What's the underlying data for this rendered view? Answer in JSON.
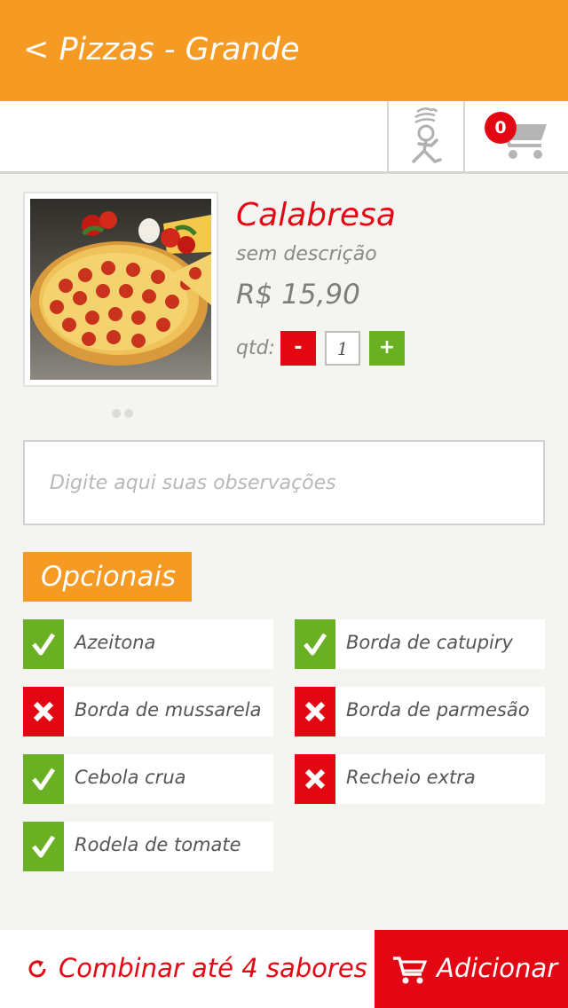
{
  "header": {
    "back_label": "< Pizzas - Grande"
  },
  "toolbar": {
    "cart_count": "0",
    "chef_icon": "delivery-chef-icon",
    "cart_icon": "cart-icon"
  },
  "product": {
    "name": "Calabresa",
    "description": "sem descrição",
    "price": "R$ 15,90",
    "qty_label": "qtd:",
    "qty_value": "1",
    "minus_label": "-",
    "plus_label": "+",
    "image_page": 1,
    "image_pages": 2
  },
  "observations": {
    "placeholder": "Digite aqui suas observações",
    "value": ""
  },
  "options": {
    "title": "Opcionais",
    "items": [
      {
        "label": "Azeitona",
        "checked": true
      },
      {
        "label": "Borda de catupiry",
        "checked": true
      },
      {
        "label": "Borda de mussarela",
        "checked": false
      },
      {
        "label": "Borda de parmesão",
        "checked": false
      },
      {
        "label": "Cebola crua",
        "checked": true
      },
      {
        "label": "Recheio extra",
        "checked": false
      },
      {
        "label": "Rodela de tomate",
        "checked": true
      }
    ]
  },
  "footer": {
    "combine_label": "Combinar até 4 sabores",
    "add_label": "Adicionar"
  },
  "colors": {
    "accent_orange": "#f59a23",
    "red": "#e30613",
    "green": "#6ab023"
  }
}
